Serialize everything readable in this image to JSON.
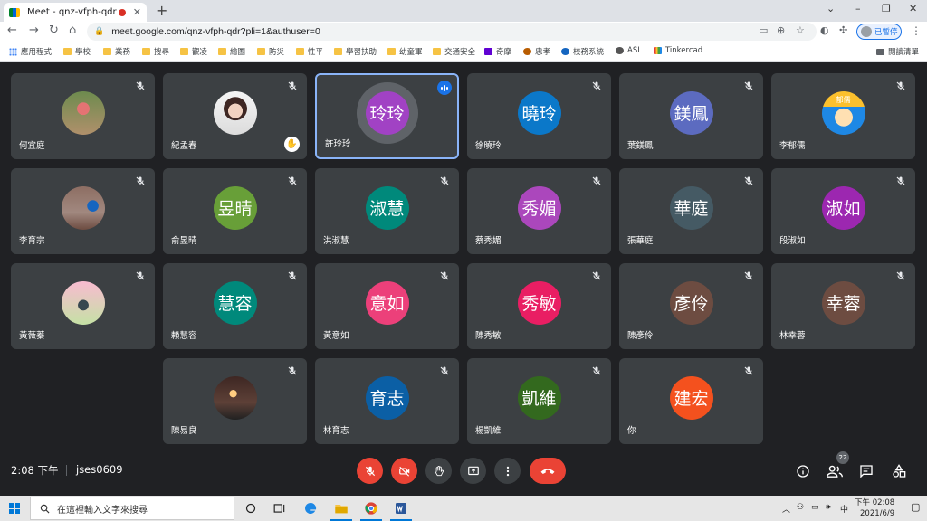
{
  "browser": {
    "tab_title": "Meet - qnz-vfph-qdr",
    "new_tab": "+",
    "url": "meet.google.com/qnz-vfph-qdr?pli=1&authuser=0",
    "profile_label": "已暫停",
    "bookmarks": [
      {
        "label": "應用程式",
        "icon": "apps-grid-icon"
      },
      {
        "label": "學校",
        "icon": "folder-icon"
      },
      {
        "label": "業務",
        "icon": "folder-icon"
      },
      {
        "label": "搜尋",
        "icon": "folder-icon"
      },
      {
        "label": "觀凌",
        "icon": "folder-icon"
      },
      {
        "label": "繪圖",
        "icon": "folder-icon"
      },
      {
        "label": "防災",
        "icon": "folder-icon"
      },
      {
        "label": "性平",
        "icon": "folder-icon"
      },
      {
        "label": "學習扶助",
        "icon": "folder-icon"
      },
      {
        "label": "幼童軍",
        "icon": "folder-icon"
      },
      {
        "label": "交通安全",
        "icon": "folder-icon"
      },
      {
        "label": "奇摩",
        "icon": "yahoo-icon"
      },
      {
        "label": "忠孝",
        "icon": "school-logo-icon"
      },
      {
        "label": "校務系統",
        "icon": "system-logo-icon"
      },
      {
        "label": "ASL",
        "icon": "globe-icon"
      },
      {
        "label": "Tinkercad",
        "icon": "tinkercad-icon"
      }
    ],
    "reading_list": "閱讀清單"
  },
  "participants": [
    {
      "name": "何宜庭",
      "avatar": "photo-outdoor-girl",
      "label": "",
      "color": ""
    },
    {
      "name": "紀孟春",
      "avatar": "photo-portrait-woman",
      "label": "",
      "color": "",
      "hand_raised": true
    },
    {
      "name": "許玲玲",
      "avatar": "initial",
      "label": "玲玲",
      "color": "#a142c4",
      "speaking": true
    },
    {
      "name": "徐曉玲",
      "avatar": "initial",
      "label": "曉玲",
      "color": "#0b78c9"
    },
    {
      "name": "葉鎂鳳",
      "avatar": "initial",
      "label": "鎂鳳",
      "color": "#5c6bc0"
    },
    {
      "name": "李郁儒",
      "avatar": "photo-cartoon-boy",
      "label": "郁儒",
      "color": "#1e88e5"
    },
    {
      "name": "李育宗",
      "avatar": "photo-kid-outdoor",
      "label": "",
      "color": ""
    },
    {
      "name": "俞昱晴",
      "avatar": "initial",
      "label": "昱晴",
      "color": "#689f38"
    },
    {
      "name": "洪淑慧",
      "avatar": "initial",
      "label": "淑慧",
      "color": "#00897b"
    },
    {
      "name": "蔡秀媚",
      "avatar": "initial",
      "label": "秀媚",
      "color": "#ab47bc"
    },
    {
      "name": "張華庭",
      "avatar": "initial",
      "label": "華庭",
      "color": "#455a64"
    },
    {
      "name": "段淑如",
      "avatar": "initial",
      "label": "淑如",
      "color": "#9c27b0"
    },
    {
      "name": "黃薇蓁",
      "avatar": "photo-girl-blossoms",
      "label": "",
      "color": ""
    },
    {
      "name": "賴慧容",
      "avatar": "initial",
      "label": "慧容",
      "color": "#00897b"
    },
    {
      "name": "黃意如",
      "avatar": "initial",
      "label": "意如",
      "color": "#ec407a"
    },
    {
      "name": "陳秀敏",
      "avatar": "initial",
      "label": "秀敏",
      "color": "#e91e63"
    },
    {
      "name": "陳彥伶",
      "avatar": "initial",
      "label": "彥伶",
      "color": "#6d4c41"
    },
    {
      "name": "林幸蓉",
      "avatar": "initial",
      "label": "幸蓉",
      "color": "#6d4c41"
    },
    {
      "name": "陳易良",
      "avatar": "photo-piano",
      "label": "",
      "color": ""
    },
    {
      "name": "林育志",
      "avatar": "initial",
      "label": "育志",
      "color": "#0b5fa5"
    },
    {
      "name": "楊凱維",
      "avatar": "initial",
      "label": "凱維",
      "color": "#33691e"
    },
    {
      "name": "你",
      "avatar": "initial",
      "label": "建宏",
      "color": "#f4511e",
      "self": true
    }
  ],
  "controls": {
    "time": "2:08 下午",
    "meeting_code": "jses0609",
    "participant_count": "22"
  },
  "taskbar": {
    "search_placeholder": "在這裡輸入文字來搜尋",
    "ime": "中",
    "clock_time": "下午 02:08",
    "clock_date": "2021/6/9"
  }
}
